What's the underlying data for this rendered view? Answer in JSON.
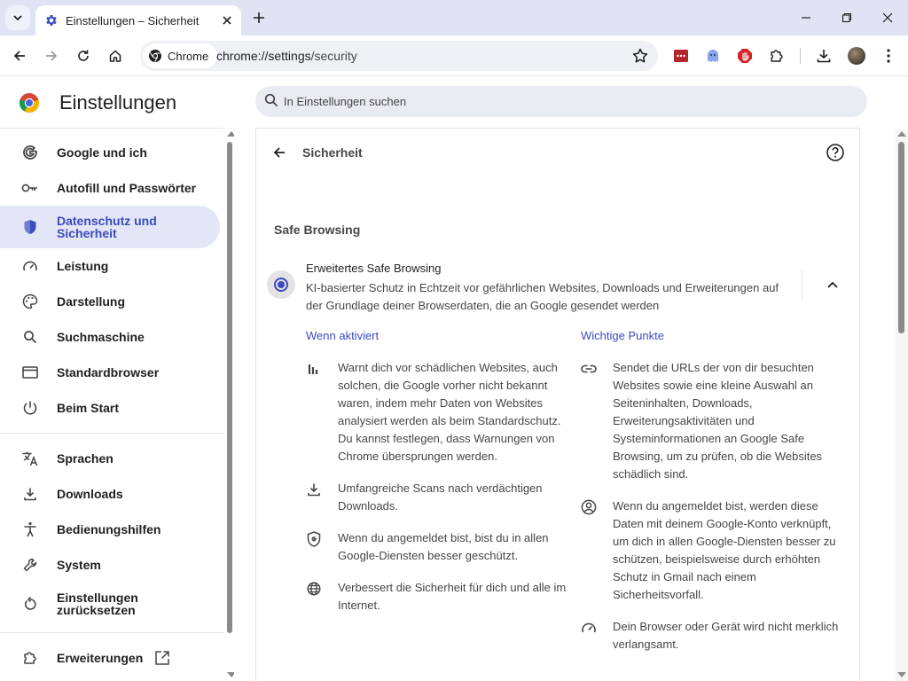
{
  "browser": {
    "tab_title": "Einstellungen – Sicherheit",
    "chip_label": "Chrome",
    "url_host": "chrome://settings",
    "url_path": "/security"
  },
  "header": {
    "title": "Einstellungen",
    "search_placeholder": "In Einstellungen suchen"
  },
  "sidebar": {
    "items": [
      {
        "label": "Google und ich",
        "icon": "google-icon"
      },
      {
        "label": "Autofill und Passwörter",
        "icon": "key-icon"
      },
      {
        "label": "Datenschutz und Sicherheit",
        "icon": "shield-icon",
        "active": true
      },
      {
        "label": "Leistung",
        "icon": "speedometer-icon"
      },
      {
        "label": "Darstellung",
        "icon": "palette-icon"
      },
      {
        "label": "Suchmaschine",
        "icon": "search-icon"
      },
      {
        "label": "Standardbrowser",
        "icon": "browser-window-icon"
      },
      {
        "label": "Beim Start",
        "icon": "power-icon"
      },
      {
        "label": "Sprachen",
        "icon": "translate-icon"
      },
      {
        "label": "Downloads",
        "icon": "download-icon"
      },
      {
        "label": "Bedienungshilfen",
        "icon": "accessibility-icon"
      },
      {
        "label": "System",
        "icon": "wrench-icon"
      },
      {
        "label": "Einstellungen zurücksetzen",
        "icon": "reset-icon"
      },
      {
        "label": "Erweiterungen",
        "icon": "puzzle-icon"
      }
    ]
  },
  "main": {
    "page_title": "Sicherheit",
    "section_title": "Safe Browsing",
    "option": {
      "title": "Erweitertes Safe Browsing",
      "description": "KI-basierter Schutz in Echtzeit vor gefährlichen Websites, Downloads und Erweiterungen auf der Grundlage deiner Browserdaten, die an Google gesendet werden",
      "selected": true
    },
    "left_column": {
      "heading": "Wenn aktiviert",
      "bullets": [
        {
          "icon": "bar-chart-icon",
          "text": "Warnt dich vor schädlichen Websites, auch solchen, die Google vorher nicht bekannt waren, indem mehr Daten von Websites analysiert werden als beim Standardschutz. Du kannst festlegen, dass Warnungen von Chrome übersprungen werden."
        },
        {
          "icon": "download-icon",
          "text": "Umfangreiche Scans nach verdächtigen Downloads."
        },
        {
          "icon": "google-shield-icon",
          "text": "Wenn du angemeldet bist, bist du in allen Google-Diensten besser geschützt."
        },
        {
          "icon": "globe-icon",
          "text": "Verbessert die Sicherheit für dich und alle im Internet."
        }
      ]
    },
    "right_column": {
      "heading": "Wichtige Punkte",
      "bullets": [
        {
          "icon": "link-icon",
          "text": "Sendet die URLs der von dir besuchten Websites sowie eine kleine Auswahl an Seiteninhalten, Downloads, Erweiterungsaktivitäten und Systeminformationen an Google Safe Browsing, um zu prüfen, ob die Websites schädlich sind."
        },
        {
          "icon": "account-circle-icon",
          "text": "Wenn du angemeldet bist, werden diese Daten mit deinem Google-Konto verknüpft, um dich in allen Google-Diensten besser zu schützen, beispielsweise durch erhöhten Schutz in Gmail nach einem Sicherheitsvorfall."
        },
        {
          "icon": "speedometer-icon",
          "text": "Dein Browser oder Gerät wird nicht merklich verlangsamt."
        }
      ]
    }
  },
  "colors": {
    "accent": "#3c4bbd",
    "active_bg": "#e3e6f6",
    "tabstrip": "#dfe3f4"
  }
}
